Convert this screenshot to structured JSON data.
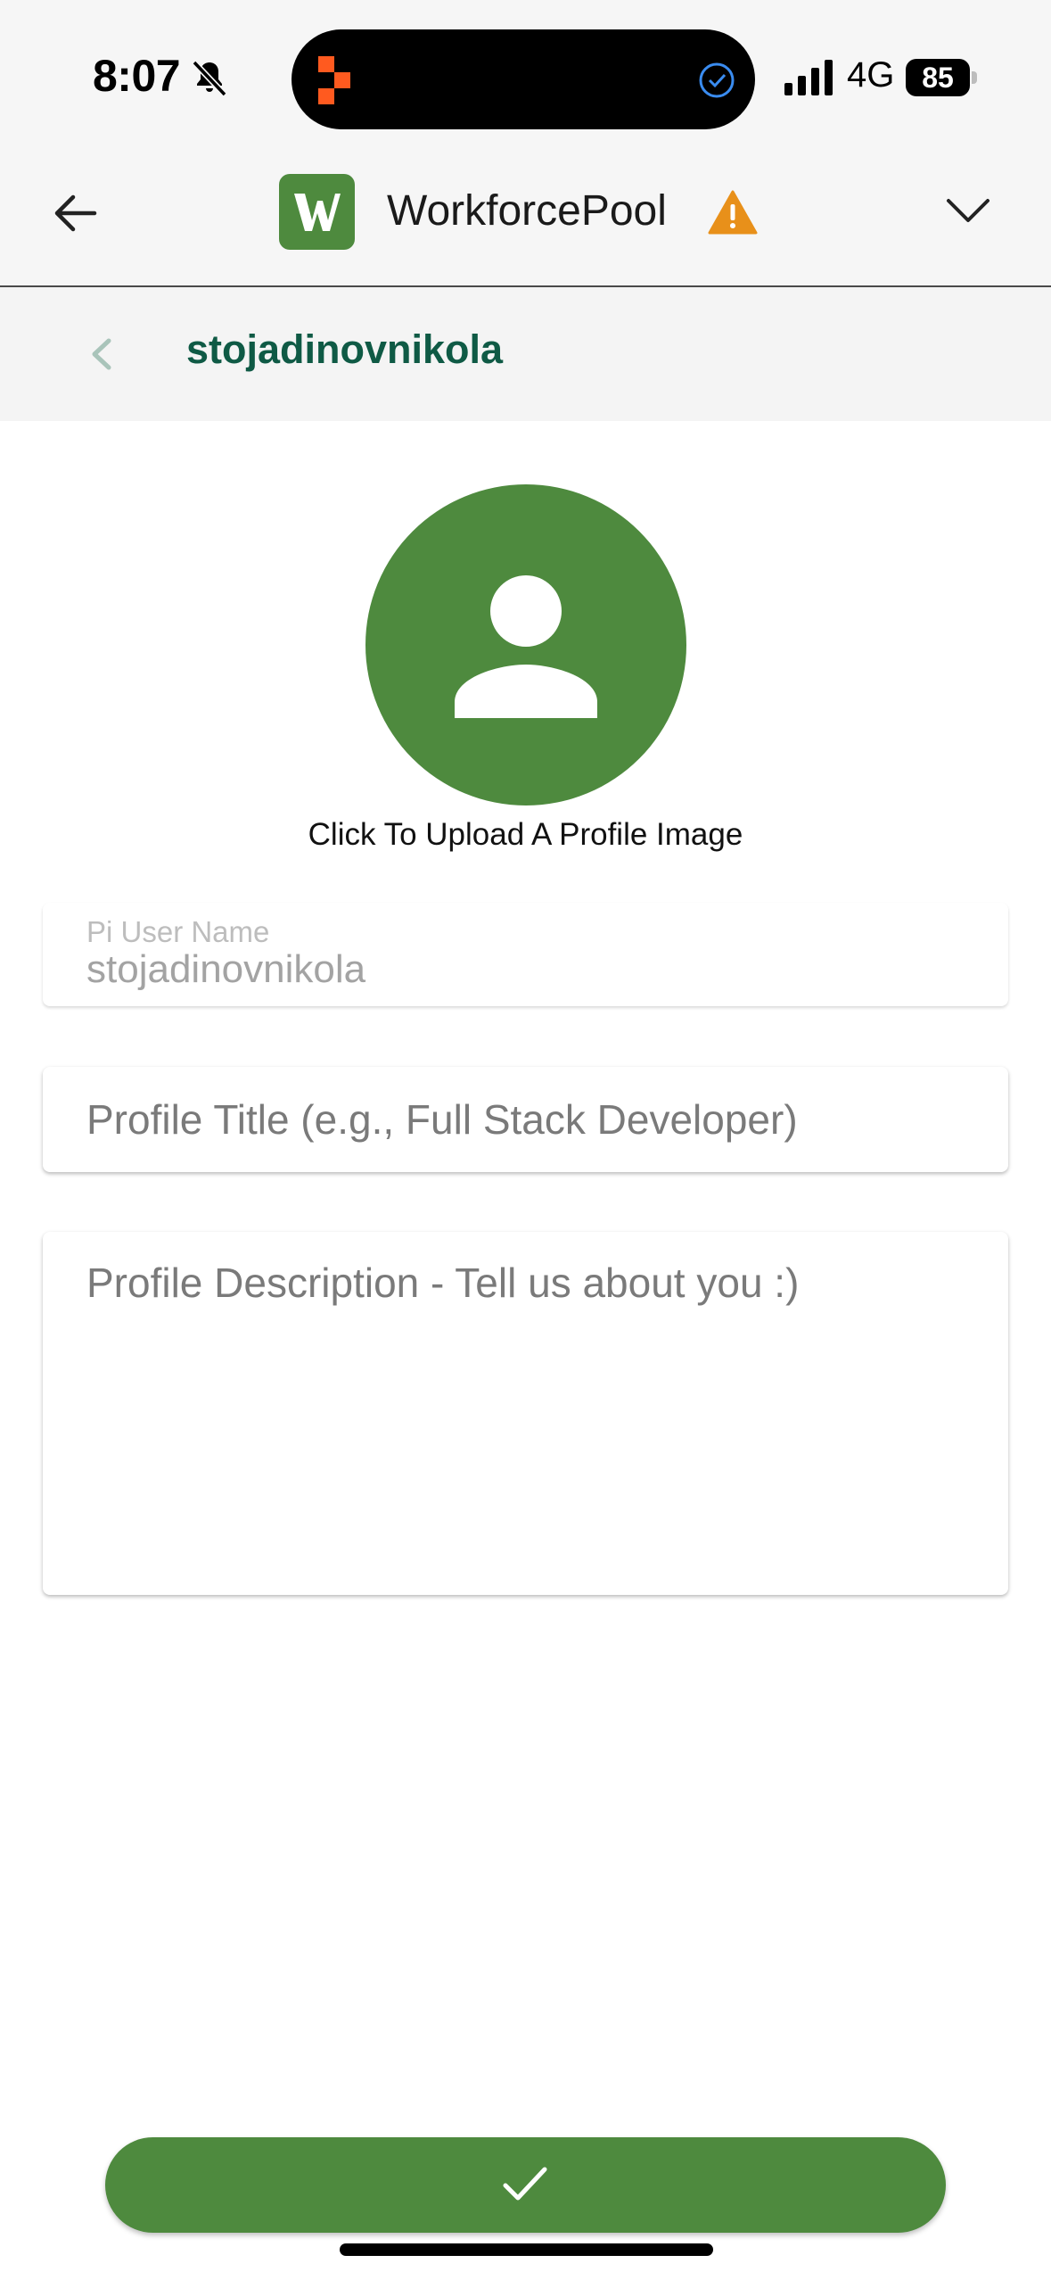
{
  "status_bar": {
    "time": "8:07",
    "network": "4G",
    "battery": "85"
  },
  "header": {
    "app_title": "WorkforcePool",
    "logo_letter": "W",
    "colors": {
      "brand": "#4e8a3e",
      "warning": "#e8901a"
    }
  },
  "sub_header": {
    "title": "stojadinovnikola"
  },
  "profile": {
    "upload_caption": "Click To Upload A Profile Image",
    "username_label": "Pi User Name",
    "username_value": "stojadinovnikola",
    "title_placeholder": "Profile Title (e.g., Full Stack Developer)",
    "description_placeholder": "Profile Description - Tell us about you :)"
  },
  "icons": {
    "back": "arrow-left-icon",
    "dropdown": "chevron-down-icon",
    "warning": "warning-icon",
    "avatar": "person-icon",
    "submit": "checkmark-icon"
  }
}
